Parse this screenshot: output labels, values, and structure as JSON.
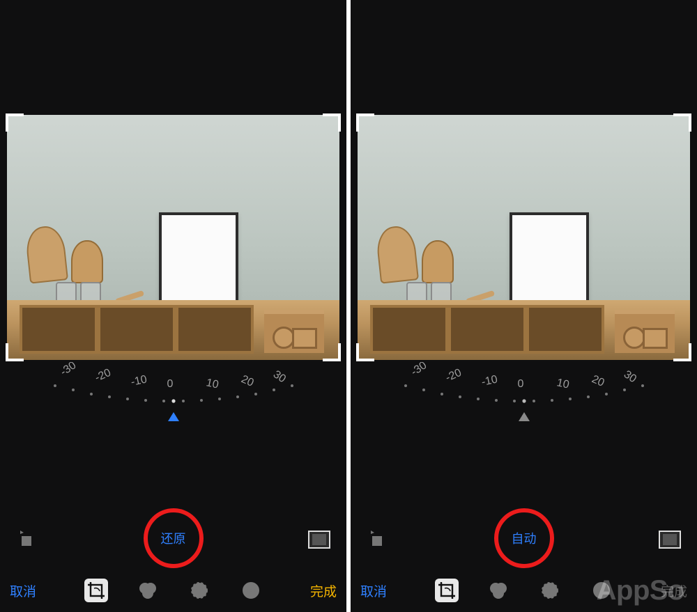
{
  "dial": {
    "ticks": [
      "-30",
      "-20",
      "-10",
      "0",
      "10",
      "20",
      "30"
    ]
  },
  "left": {
    "center_action": "还原",
    "cancel": "取消",
    "done": "完成",
    "marker_color": "blue"
  },
  "right": {
    "center_action": "自动",
    "cancel": "取消",
    "done": "完成",
    "marker_color": "gray"
  },
  "icons": {
    "rotate": "rotate-icon",
    "aspect": "aspect-icon",
    "crop": "crop-icon",
    "filters": "filters-icon",
    "adjust": "adjust-icon",
    "more": "more-icon"
  },
  "watermark": "AppSo"
}
